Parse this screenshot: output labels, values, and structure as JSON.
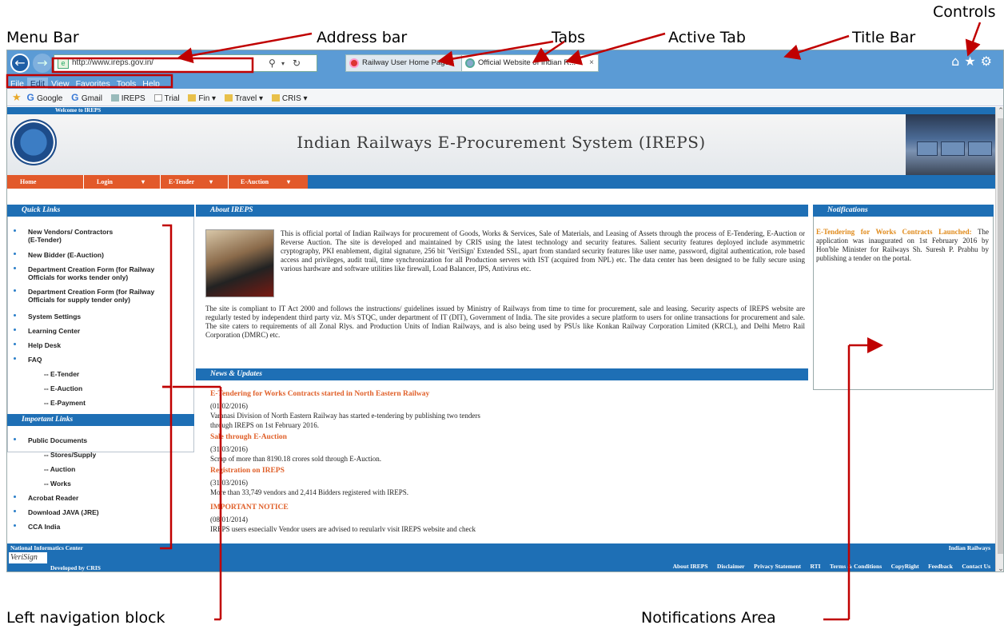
{
  "annotations": {
    "menu_bar": "Menu Bar",
    "address_bar": "Address bar",
    "tabs": "Tabs",
    "active_tab": "Active Tab",
    "title_bar": "Title Bar",
    "controls": "Controls",
    "left_nav": "Left navigation block",
    "notifications_area": "Notifications Area",
    "line_color": "#c00000"
  },
  "browser": {
    "url": "http://www.ireps.gov.in/",
    "tabs": [
      {
        "label": "Railway User Home Page",
        "active": false
      },
      {
        "label": "Official Website of Indian R...",
        "active": true
      }
    ],
    "menu": [
      "File",
      "Edit",
      "View",
      "Favorites",
      "Tools",
      "Help"
    ],
    "favorites": [
      "Google",
      "Gmail",
      "IREPS",
      "Trial",
      "Fin ▾",
      "Travel ▾",
      "CRIS ▾"
    ],
    "title_bar_color": "#5b9bd5"
  },
  "site": {
    "welcome": "Welcome to IREPS",
    "title": "Indian Railways E-Procurement System (IREPS)",
    "nav": [
      "Home",
      "Login",
      "E-Tender",
      "E-Auction"
    ],
    "brand_blue": "#1e6fb5",
    "brand_orange": "#e2592a"
  },
  "quick_links": {
    "heading": "Quick Links",
    "items": [
      "New Vendors/ Contractors",
      "(E-Tender)",
      "New Bidder (E-Auction)",
      "Department Creation Form (for Railway",
      "Officials for works tender only)",
      "Department Creation Form (for Railway",
      "Officials for supply tender only)",
      "System Settings",
      "Learning Center",
      "Help Desk",
      "FAQ",
      "-- E-Tender",
      "-- E-Auction",
      "-- E-Payment"
    ]
  },
  "important_links": {
    "heading": "Important Links",
    "items": [
      "Public Documents",
      "-- Stores/Supply",
      "-- Auction",
      "-- Works",
      "Acrobat Reader",
      "Download JAVA (JRE)",
      "CCA India"
    ]
  },
  "about": {
    "heading": "About IREPS",
    "para1": "This is official portal of Indian Railways for procurement of Goods, Works & Services, Sale of Materials, and Leasing of Assets through the process of E-Tendering, E-Auction or Reverse Auction. The site is developed and maintained by CRIS using the latest technology and security features. Salient security features deployed include asymmetric cryptography, PKI enablement, digital signature, 256 bit 'VeriSign' Extended SSL, apart from standard security features like user name, password, digital authentication, role based access and privileges, audit trail, time synchronization for all Production servers with IST (acquired from NPL) etc. The data center has been designed to be fully secure using various hardware and software utilities like firewall, Load Balancer, IPS, Antivirus etc.",
    "para2": "The site is compliant to IT Act 2000 and follows the instructions/ guidelines issued by Ministry of Railways from time to time for procurement, sale and leasing. Security aspects of IREPS website are regularly tested by independent third party viz. M/s STQC, under department of IT (DIT), Government of India. The site provides a secure platform to users for online transactions for procurement and sale. The site caters to requirements of all Zonal Rlys. and Production Units of Indian Railways, and is also being used by PSUs like Konkan Railway Corporation Limited (KRCL), and Delhi Metro Rail Corporation (DMRC) etc."
  },
  "news": {
    "heading": "News & Updates",
    "items": [
      {
        "title": "E-Tendering for Works Contracts started in North Eastern Railway",
        "date": "(01/02/2016)",
        "body1": "Varanasi Division of North Eastern Railway has started e-tendering by publishing two tenders",
        "body2": "through IREPS on 1st February 2016."
      },
      {
        "title": "Sale through E-Auction",
        "date": "(31/03/2016)",
        "body1": "Scrap of more than 8190.18 crores sold through E-Auction.",
        "body2": ""
      },
      {
        "title": "Registration on IREPS",
        "date": "(31/03/2016)",
        "body1": "More than 33,749 vendors and 2,414 Bidders registered with IREPS.",
        "body2": ""
      },
      {
        "title": "IMPORTANT NOTICE",
        "date": "(08/01/2014)",
        "body1": "IREPS users especially Vendor users are advised to regularly visit IREPS website and check",
        "body2": ""
      }
    ]
  },
  "notifications": {
    "heading": "Notifications",
    "highlight": "E-Tendering for Works Contracts Launched:",
    "body": " The application was inaugurated on 1st February 2016 by Hon'ble Minister for Railways Sh. Suresh P. Prabhu by publishing a tender on the portal."
  },
  "footer": {
    "left_top": "National Informatics Center",
    "left_bottom": "Developed by CRIS",
    "verisign": "VeriSign",
    "right_top": "Indian Railways",
    "links": [
      "About IREPS",
      "Disclaimer",
      "Privacy Statement",
      "RTI",
      "Terms & Conditions",
      "CopyRight",
      "Feedback",
      "Contact Us"
    ]
  }
}
